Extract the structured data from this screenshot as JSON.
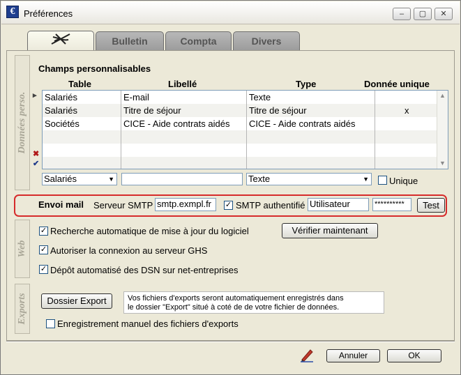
{
  "window": {
    "title": "Préférences",
    "icon_letter": "€"
  },
  "tabs": [
    {
      "label": "",
      "icon": "dragonfly-logo-icon",
      "active": true
    },
    {
      "label": "Bulletin",
      "active": false
    },
    {
      "label": "Compta",
      "active": false
    },
    {
      "label": "Divers",
      "active": false
    }
  ],
  "sections": {
    "donnees_perso": "Données perso.",
    "web": "Web",
    "exports": "Exports"
  },
  "custom_fields": {
    "title": "Champs personnalisables",
    "columns": [
      "Table",
      "Libellé",
      "Type",
      "Donnée unique"
    ],
    "rows": [
      {
        "table": "Salariés",
        "libelle": "E-mail",
        "type": "Texte",
        "unique": ""
      },
      {
        "table": "Salariés",
        "libelle": "Titre de séjour",
        "type": "Titre de séjour",
        "unique": "x"
      },
      {
        "table": "Sociétés",
        "libelle": "CICE - Aide contrats aidés",
        "type": "CICE - Aide contrats aidés",
        "unique": ""
      }
    ],
    "delete_mark": "✖",
    "validate_mark": "✔",
    "current_mark": "▸",
    "edit": {
      "table_value": "Salariés",
      "libelle_value": "",
      "type_value": "Texte",
      "unique_label": "Unique",
      "unique_checked": false
    }
  },
  "mail": {
    "title": "Envoi mail",
    "smtp_label": "Serveur SMTP",
    "smtp_value": "smtp.exmpl.fr",
    "auth_label": "SMTP authentifié",
    "auth_checked": true,
    "user_value": "Utilisateur",
    "password_value": "**********",
    "test_label": "Test"
  },
  "web": {
    "auto_update_label": "Recherche automatique de mise à jour du logiciel",
    "auto_update_checked": true,
    "check_now_label": "Vérifier maintenant",
    "ghs_label": "Autoriser la connexion au serveur GHS",
    "ghs_checked": true,
    "dsn_label": "Dépôt automatisé des DSN sur net-entreprises",
    "dsn_checked": true
  },
  "exports": {
    "folder_button": "Dossier Export",
    "note_line1": "Vos fichiers d'exports seront automatiquement enregistrés dans",
    "note_line2": "le dossier \"Export\" situé à coté de de votre fichier de données.",
    "manual_label": "Enregistrement manuel des fichiers d'exports",
    "manual_checked": false
  },
  "footer": {
    "cancel_label": "Annuler",
    "ok_label": "OK"
  },
  "colors": {
    "mail_highlight_border": "#d62b2b",
    "window_background": "#ece9d8",
    "input_border": "#7f9db9"
  }
}
